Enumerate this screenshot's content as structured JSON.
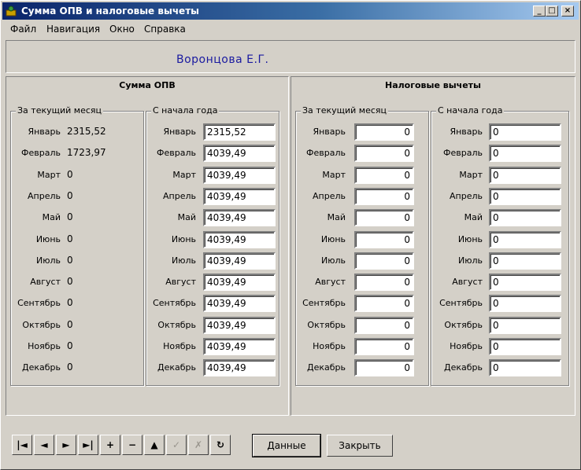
{
  "window": {
    "title": "Сумма ОПВ и налоговые вычеты",
    "controls": {
      "minimize": "_",
      "maximize": "□",
      "close": "×"
    }
  },
  "menu": [
    "Файл",
    "Навигация",
    "Окно",
    "Справка"
  ],
  "header": {
    "name": "Воронцова Е.Г."
  },
  "months": [
    "Январь",
    "Февраль",
    "Март",
    "Апрель",
    "Май",
    "Июнь",
    "Июль",
    "Август",
    "Сентябрь",
    "Октябрь",
    "Ноябрь",
    "Декабрь"
  ],
  "opv": {
    "title": "Сумма ОПВ",
    "current_month": {
      "title": "За текущий месяц",
      "values": [
        "2315,52",
        "1723,97",
        "0",
        "0",
        "0",
        "0",
        "0",
        "0",
        "0",
        "0",
        "0",
        "0"
      ]
    },
    "year_start": {
      "title": "С начала года",
      "values": [
        "2315,52",
        "4039,49",
        "4039,49",
        "4039,49",
        "4039,49",
        "4039,49",
        "4039,49",
        "4039,49",
        "4039,49",
        "4039,49",
        "4039,49",
        "4039,49"
      ]
    }
  },
  "tax": {
    "title": "Налоговые вычеты",
    "current_month": {
      "title": "За текущий месяц",
      "values": [
        "0",
        "0",
        "0",
        "0",
        "0",
        "0",
        "0",
        "0",
        "0",
        "0",
        "0",
        "0"
      ]
    },
    "year_start": {
      "title": "С начала года",
      "values": [
        "0",
        "0",
        "0",
        "0",
        "0",
        "0",
        "0",
        "0",
        "0",
        "0",
        "0",
        "0"
      ]
    }
  },
  "navigator": {
    "buttons": [
      {
        "name": "first-record-button",
        "icon": "first-icon",
        "glyph": "|◄",
        "enabled": true
      },
      {
        "name": "prior-record-button",
        "icon": "prior-icon",
        "glyph": "◄",
        "enabled": true
      },
      {
        "name": "next-record-button",
        "icon": "next-icon",
        "glyph": "►",
        "enabled": true
      },
      {
        "name": "last-record-button",
        "icon": "last-icon",
        "glyph": "►|",
        "enabled": true
      },
      {
        "name": "insert-record-button",
        "icon": "plus-icon",
        "glyph": "+",
        "enabled": true
      },
      {
        "name": "delete-record-button",
        "icon": "minus-icon",
        "glyph": "−",
        "enabled": true
      },
      {
        "name": "edit-record-button",
        "icon": "up-triangle-icon",
        "glyph": "▲",
        "enabled": true
      },
      {
        "name": "post-record-button",
        "icon": "check-icon",
        "glyph": "✓",
        "enabled": false
      },
      {
        "name": "cancel-record-button",
        "icon": "cross-icon",
        "glyph": "✗",
        "enabled": false
      },
      {
        "name": "refresh-button",
        "icon": "refresh-icon",
        "glyph": "↻",
        "enabled": true
      }
    ]
  },
  "buttons": {
    "data": "Данные",
    "close": "Закрыть"
  }
}
